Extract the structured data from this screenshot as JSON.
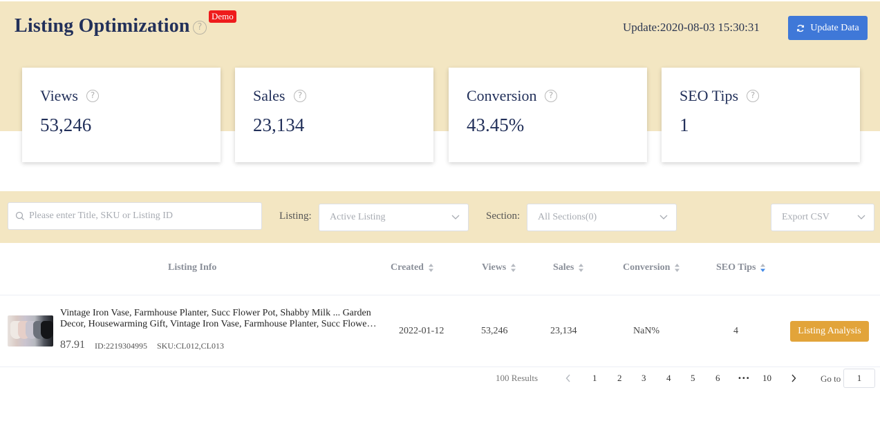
{
  "header": {
    "title": "Listing Optimization",
    "help_glyph": "?",
    "demo_badge": "Demo",
    "update_text": "Update:2020-08-03 15:30:31",
    "update_button": "Update Data"
  },
  "stats": [
    {
      "label": "Views",
      "value": "53,246"
    },
    {
      "label": "Sales",
      "value": "23,134"
    },
    {
      "label": "Conversion",
      "value": "43.45%"
    },
    {
      "label": "SEO Tips",
      "value": "1"
    }
  ],
  "filters": {
    "search_placeholder": "Please enter Title, SKU or Listing ID",
    "listing_label": "Listing:",
    "listing_value": "Active Listing",
    "section_label": "Section:",
    "section_value": "All Sections(0)",
    "export_value": "Export CSV"
  },
  "table": {
    "columns": [
      "Listing Info",
      "Created",
      "Views",
      "Sales",
      "Conversion",
      "SEO Tips"
    ],
    "active_sort_column": "SEO Tips",
    "rows": [
      {
        "title_line1": "Vintage Iron Vase, Farmhouse Planter, Succ Flower Pot, Shabby Milk ... Garden",
        "title_line2": "Decor, Housewarming Gift, Vintage Iron Vase, Farmhouse Planter, Succ Flower Pot",
        "price": "87.91",
        "id": "ID:2219304995",
        "sku": "SKU:CL012,CL013",
        "created": "2022-01-12",
        "views": "53,246",
        "sales": "23,134",
        "conversion": "NaN%",
        "seo_tips": "4",
        "action": "Listing Analysis"
      }
    ]
  },
  "pagination": {
    "results": "100 Results",
    "pages": [
      "1",
      "2",
      "3",
      "4",
      "5",
      "6",
      "•••",
      "10"
    ],
    "goto_label": "Go to",
    "goto_value": "1"
  },
  "colors": {
    "band": "#f3e6c2",
    "primary": "#3f78d8",
    "accent": "#e2a43a",
    "badge": "#ee1c1c",
    "sort_active": "#3f88e8"
  }
}
